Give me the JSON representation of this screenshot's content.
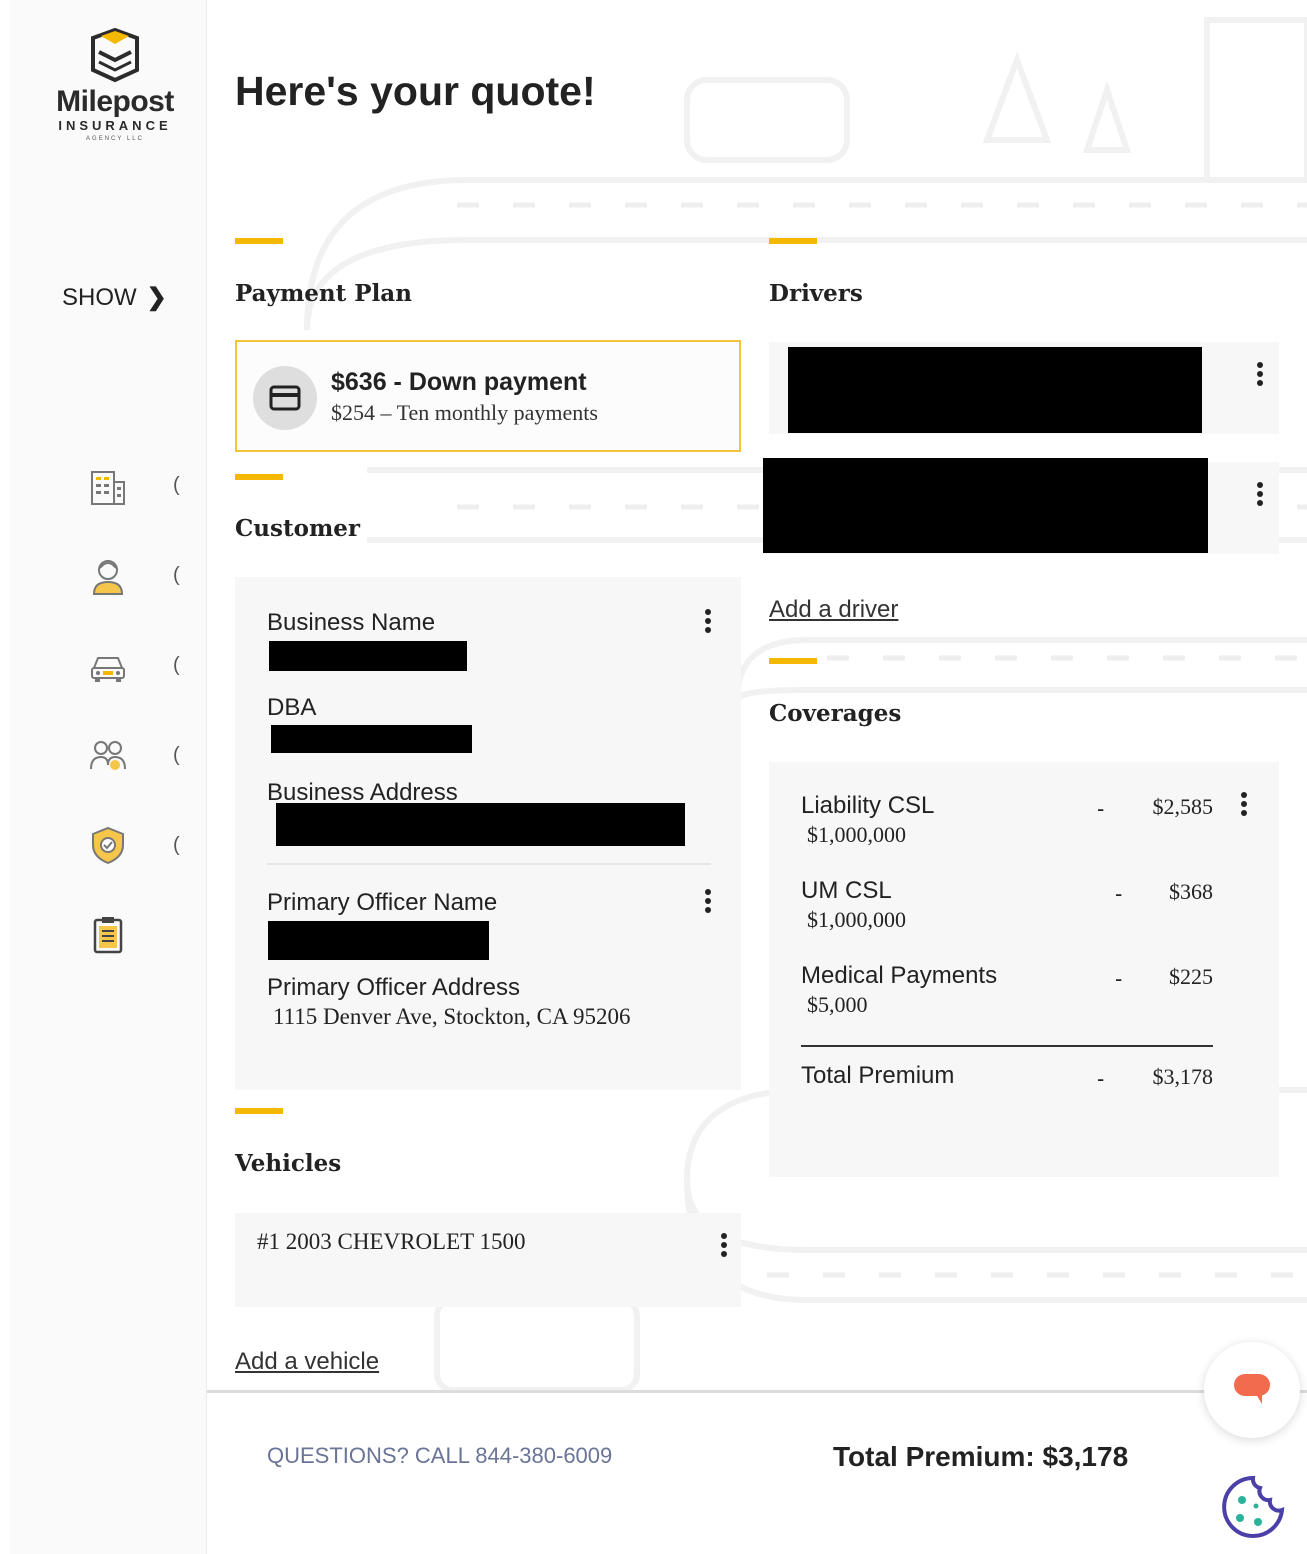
{
  "brand": {
    "name": "Milepost",
    "sub": "INSURANCE",
    "agency": "AGENCY LLC",
    "accent_color": "#f5b800"
  },
  "sidebar": {
    "show_label": "SHOW",
    "show_chevron": "❯",
    "items": [
      {
        "icon": "business-icon"
      },
      {
        "icon": "officer-icon"
      },
      {
        "icon": "vehicle-icon"
      },
      {
        "icon": "drivers-icon"
      },
      {
        "icon": "shield-icon"
      },
      {
        "icon": "clipboard-icon"
      }
    ],
    "item_marker": "("
  },
  "page": {
    "title": "Here's your quote!"
  },
  "payment": {
    "heading": "Payment Plan",
    "down_payment": "$636 - Down payment",
    "monthly": "$254 – Ten monthly payments"
  },
  "customer": {
    "heading": "Customer",
    "business_name_label": "Business Name",
    "dba_label": "DBA",
    "business_address_label": "Business Address",
    "primary_officer_name_label": "Primary Officer Name",
    "primary_officer_address_label": "Primary Officer Address",
    "primary_officer_address": "1115 Denver Ave, Stockton, CA 95206"
  },
  "vehicles": {
    "heading": "Vehicles",
    "items": [
      "#1 2003 CHEVROLET 1500"
    ],
    "add_link": "Add a vehicle"
  },
  "drivers": {
    "heading": "Drivers",
    "add_link": "Add a driver"
  },
  "coverages": {
    "heading": "Coverages",
    "rows": [
      {
        "name": "Liability CSL",
        "limit": "$1,000,000",
        "dash": "-",
        "amount": "$2,585"
      },
      {
        "name": "UM CSL",
        "limit": "$1,000,000",
        "dash": "-",
        "amount": "$368"
      },
      {
        "name": "Medical Payments",
        "limit": "$5,000",
        "dash": "-",
        "amount": "$225"
      }
    ],
    "total_label": "Total Premium",
    "total_dash": "-",
    "total_amount": "$3,178"
  },
  "footer": {
    "questions": "QUESTIONS? CALL 844-380-6009",
    "total": "Total Premium: $3,178"
  }
}
